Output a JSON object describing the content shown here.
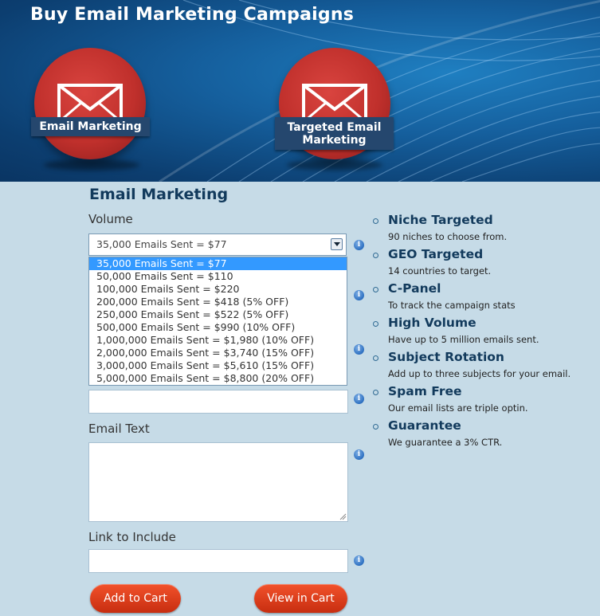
{
  "header": {
    "title": "Buy Email Marketing Campaigns",
    "badges": [
      {
        "label": "Email Marketing",
        "icon": "envelope-icon"
      },
      {
        "label_line1": "Targeted Email",
        "label_line2": "Marketing",
        "icon": "envelope-icon"
      }
    ]
  },
  "form": {
    "section_title": "Email Marketing",
    "volume_label": "Volume",
    "volume_selected": "35,000 Emails Sent = $77",
    "volume_options": [
      "35,000 Emails Sent = $77",
      "50,000 Emails Sent = $110",
      "100,000 Emails Sent = $220",
      "200,000 Emails Sent = $418 (5% OFF)",
      "250,000 Emails Sent = $522 (5% OFF)",
      "500,000 Emails Sent = $990 (10% OFF)",
      "1,000,000 Emails Sent = $1,980 (10% OFF)",
      "2,000,000 Emails Sent = $3,740 (15% OFF)",
      "3,000,000 Emails Sent = $5,610 (15% OFF)",
      "5,000,000 Emails Sent = $8,800 (20% OFF)"
    ],
    "email_text_label": "Email Text",
    "link_label": "Link to Include",
    "add_to_cart": "Add to Cart",
    "view_in_cart": "View in Cart"
  },
  "features": [
    {
      "title": "Niche Targeted",
      "desc": "90 niches to choose from."
    },
    {
      "title": "GEO Targeted",
      "desc": "14 countries to target."
    },
    {
      "title": "C-Panel",
      "desc": "To track the campaign stats"
    },
    {
      "title": "High Volume",
      "desc": "Have up to 5 million emails sent."
    },
    {
      "title": "Subject Rotation",
      "desc": "Add up to three subjects for your email."
    },
    {
      "title": "Spam Free",
      "desc": "Our email lists are triple optin."
    },
    {
      "title": "Guarantee",
      "desc": "We guarantee a 3% CTR."
    }
  ],
  "colors": {
    "page_bg": "#c6dbe7",
    "heading": "#123a5c",
    "button": "#d83a18",
    "badge_red": "#c0302c",
    "banner": "#25476e",
    "selected_option": "#3399ff"
  }
}
